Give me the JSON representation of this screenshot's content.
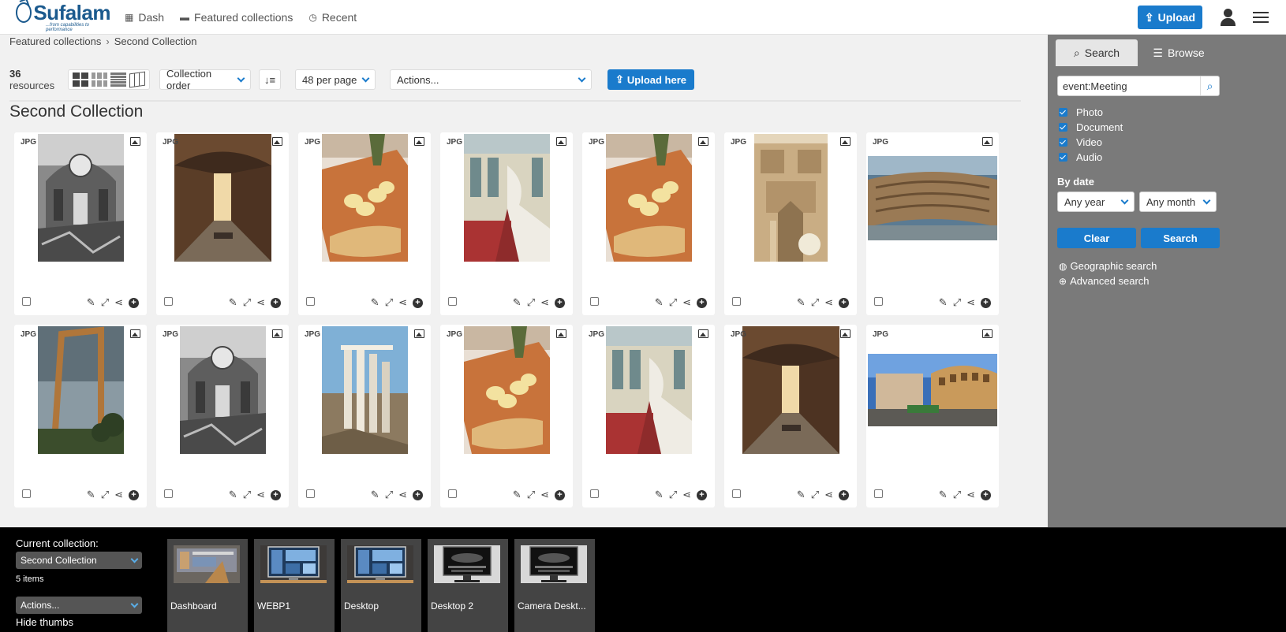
{
  "header": {
    "logo": "Sufalam",
    "logo_tagline": "...from capabilities to performance",
    "nav": [
      {
        "label": "Dash",
        "icon": "grid-icon"
      },
      {
        "label": "Featured collections",
        "icon": "folder-icon"
      },
      {
        "label": "Recent",
        "icon": "clock-icon"
      }
    ],
    "upload_label": "Upload"
  },
  "breadcrumb": {
    "parent": "Featured collections",
    "current": "Second Collection"
  },
  "toolbar": {
    "count_number": "36",
    "count_suffix": " resources",
    "order": "Collection order",
    "per_page": "48 per page",
    "actions": "Actions...",
    "upload_here": "Upload here"
  },
  "collection_title": "Second Collection",
  "resources": [
    {
      "type": "JPG",
      "art": "gothic"
    },
    {
      "type": "JPG",
      "art": "cloister"
    },
    {
      "type": "JPG",
      "art": "oil"
    },
    {
      "type": "JPG",
      "art": "palace"
    },
    {
      "type": "JPG",
      "art": "oil"
    },
    {
      "type": "JPG",
      "art": "facade"
    },
    {
      "type": "JPG",
      "art": "amphitheatre"
    },
    {
      "type": "JPG",
      "art": "frame"
    },
    {
      "type": "JPG",
      "art": "gothic"
    },
    {
      "type": "JPG",
      "art": "columns"
    },
    {
      "type": "JPG",
      "art": "oil"
    },
    {
      "type": "JPG",
      "art": "palace"
    },
    {
      "type": "JPG",
      "art": "cloister"
    },
    {
      "type": "JPG",
      "art": "colosseum"
    }
  ],
  "sidebar": {
    "tabs": [
      {
        "label": "Search",
        "icon": "search-icon"
      },
      {
        "label": "Browse",
        "icon": "list-icon"
      }
    ],
    "search_value": "event:Meeting",
    "filters": [
      "Photo",
      "Document",
      "Video",
      "Audio"
    ],
    "by_date_label": "By date",
    "year": "Any year",
    "month": "Any month",
    "clear_label": "Clear",
    "search_label": "Search",
    "geo_search": "Geographic search",
    "advanced_search": "Advanced search"
  },
  "collection_bar": {
    "current_label": "Current collection:",
    "current_value": "Second Collection",
    "items": "5 items",
    "actions": "Actions...",
    "hide_thumbs": "Hide thumbs",
    "collections": [
      {
        "name": "Dashboard",
        "art": "dashboard"
      },
      {
        "name": "WEBP1",
        "art": "monitor-blue"
      },
      {
        "name": "Desktop",
        "art": "monitor-blue"
      },
      {
        "name": "Desktop 2",
        "art": "monitor-dark"
      },
      {
        "name": "Camera Deskt...",
        "art": "monitor-dark"
      }
    ]
  },
  "colors": {
    "accent": "#1a7bcc",
    "sidebar": "#7a7a7a",
    "bar": "#000000"
  }
}
